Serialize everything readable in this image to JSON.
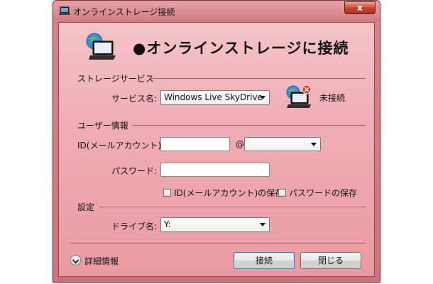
{
  "window": {
    "title": "オンラインストレージ接続",
    "close_symbol": "x"
  },
  "header": {
    "title": "●オンラインストレージに接続",
    "icon": "laptop-globe-icon"
  },
  "storage": {
    "section_label": "ストレージサービス",
    "service_label": "サービス名:",
    "service_value": "Windows Live SkyDrive",
    "status_icon": "laptop-disconnected-icon",
    "status_text": "未接続"
  },
  "user": {
    "section_label": "ユーザー情報",
    "id_label": "ID(メールアカウント):",
    "id_value": "",
    "at_sign": "@",
    "domain_value": "",
    "password_label": "パスワード:",
    "password_value": "",
    "save_id_label": "ID(メールアカウント)の保存",
    "save_id_checked": false,
    "save_password_label": "パスワードの保存",
    "save_password_checked": false
  },
  "settings": {
    "section_label": "設定",
    "drive_label": "ドライブ名:",
    "drive_value": "Y:"
  },
  "footer": {
    "details_label": "詳細情報",
    "connect_label": "接続",
    "close_label": "閉じる"
  }
}
